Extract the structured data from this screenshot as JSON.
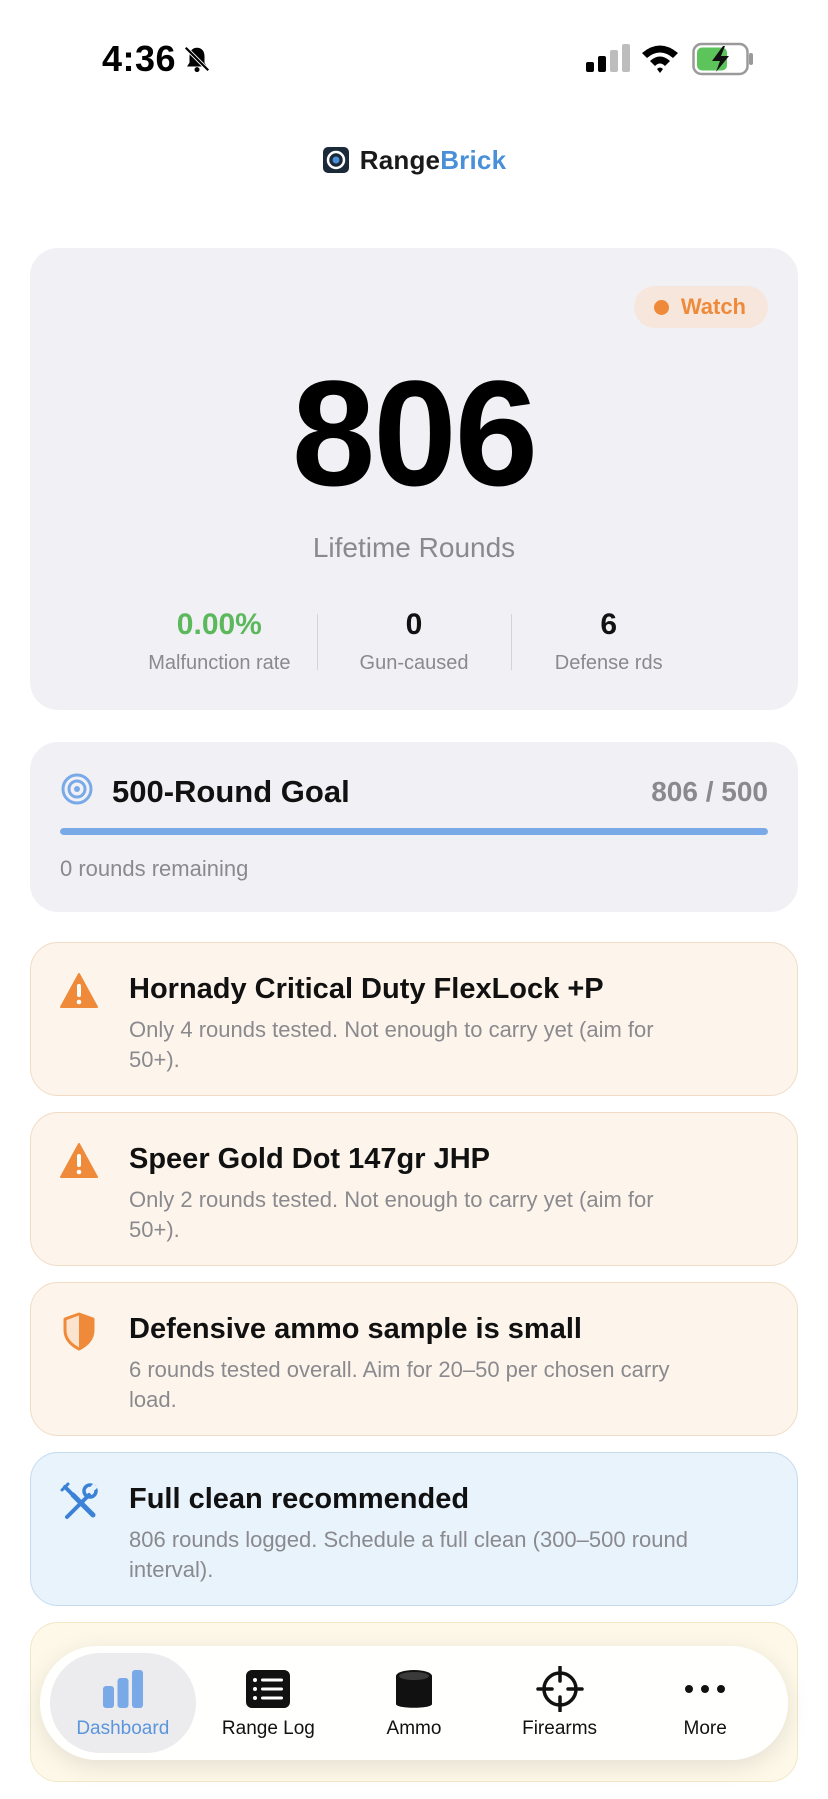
{
  "status": {
    "time": "4:36"
  },
  "logo": {
    "name_part1": "Range",
    "name_part2": "Brick"
  },
  "hero": {
    "badge": "Watch",
    "number": "806",
    "caption": "Lifetime Rounds",
    "stats": [
      {
        "value": "0.00%",
        "label": "Malfunction rate"
      },
      {
        "value": "0",
        "label": "Gun-caused"
      },
      {
        "value": "6",
        "label": "Defense rds"
      }
    ]
  },
  "goal": {
    "title": "500-Round Goal",
    "progress_text": "806 / 500",
    "progress_fraction": 1.0,
    "remaining": "0 rounds remaining"
  },
  "alerts": [
    {
      "icon": "warning-triangle-icon",
      "title": "Hornady Critical Duty FlexLock +P",
      "text": "Only 4 rounds tested. Not enough to carry yet (aim for 50+)."
    },
    {
      "icon": "warning-triangle-icon",
      "title": "Speer Gold Dot 147gr JHP",
      "text": "Only 2 rounds tested. Not enough to carry yet (aim for 50+)."
    },
    {
      "icon": "shield-icon",
      "title": "Defensive ammo sample is small",
      "text": "6 rounds tested overall. Aim for 20–50 per chosen carry load."
    },
    {
      "icon": "tools-icon",
      "title": "Full clean recommended",
      "text": "806 rounds logged. Schedule a full clean (300–500 round interval)."
    }
  ],
  "tabs": [
    {
      "label": "Dashboard",
      "icon": "bar-chart-icon",
      "active": true
    },
    {
      "label": "Range Log",
      "icon": "list-icon",
      "active": false
    },
    {
      "label": "Ammo",
      "icon": "ammo-can-icon",
      "active": false
    },
    {
      "label": "Firearms",
      "icon": "crosshair-icon",
      "active": false
    },
    {
      "label": "More",
      "icon": "more-dots-icon",
      "active": false
    }
  ],
  "colors": {
    "accent_blue": "#4a90d9",
    "watch_orange": "#ef8a3a",
    "success_green": "#5cb85c",
    "muted_gray": "#8a8a8e"
  }
}
